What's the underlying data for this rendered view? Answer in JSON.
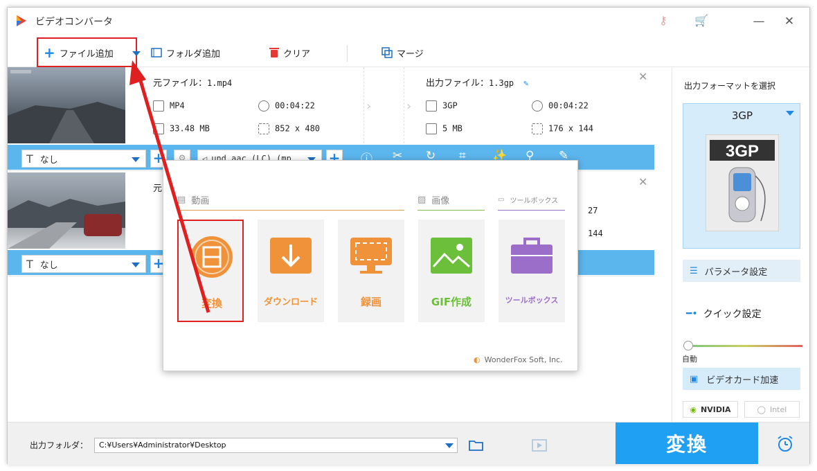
{
  "app": {
    "title": "ビデオコンバータ"
  },
  "toolbar": {
    "add_file": "ファイル追加",
    "add_folder": "フォルダ追加",
    "clear": "クリア",
    "merge": "マージ"
  },
  "files": [
    {
      "source_label": "元ファイル：",
      "source_name": "1.mp4",
      "src_format": "MP4",
      "src_duration": "00:04:22",
      "src_size": "33.48 MB",
      "src_res": "852 x 480",
      "output_label": "出力ファイル：",
      "output_name": "1.3gp",
      "out_format": "3GP",
      "out_duration": "00:04:22",
      "out_size": "5 MB",
      "out_res": "176 x 144",
      "subtitle": "なし",
      "audio": "und aac (LC) (mp"
    },
    {
      "source_label": "元",
      "out_duration_partial": "27",
      "out_res_partial": "144",
      "subtitle": "なし"
    }
  ],
  "popup": {
    "sections": {
      "video": "動画",
      "image": "画像",
      "toolbox": "ツールボックス"
    },
    "tiles": [
      {
        "label": "変換",
        "color": "#f0923a"
      },
      {
        "label": "ダウンロード",
        "color": "#f0923a"
      },
      {
        "label": "録画",
        "color": "#f0923a"
      },
      {
        "label": "GIF作成",
        "color": "#6cbf3a"
      },
      {
        "label": "ツールボックス",
        "color": "#9b6fc9"
      }
    ],
    "brand": "WonderFox Soft, Inc."
  },
  "right": {
    "select_format": "出力フォーマットを選択",
    "format": "3GP",
    "param": "パラメータ設定",
    "quick": "クイック設定",
    "auto": "自動",
    "gpu": "ビデオカード加速",
    "nvidia": "NVIDIA",
    "intel": "Intel"
  },
  "bottom": {
    "folder_label": "出力フォルダ：",
    "path": "C:¥Users¥Administrator¥Desktop",
    "convert": "変換"
  },
  "colors": {
    "accent": "#1fa0f2",
    "bar": "#5cb6ee",
    "highlight": "#e02020",
    "orange": "#f0923a"
  }
}
